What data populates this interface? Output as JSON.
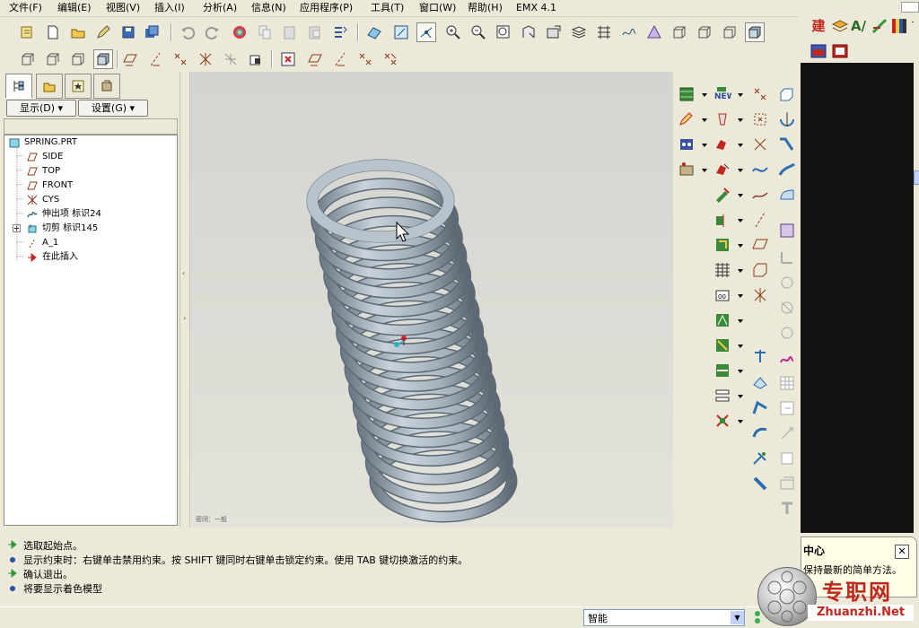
{
  "menu": [
    "文件(F)",
    "编辑(E)",
    "视图(V)",
    "插入(I)",
    "分析(A)",
    "信息(N)",
    "应用程序(P)",
    "工具(T)",
    "窗口(W)",
    "帮助(H)",
    "EMX 4.1"
  ],
  "panel": {
    "show_label": "显示(D)",
    "settings_label": "设置(G)"
  },
  "tree": [
    {
      "label": "SPRING.PRT",
      "icon": "part-icon"
    },
    {
      "label": "SIDE",
      "icon": "datum-plane-icon"
    },
    {
      "label": "TOP",
      "icon": "datum-plane-icon"
    },
    {
      "label": "FRONT",
      "icon": "datum-plane-icon"
    },
    {
      "label": "CYS",
      "icon": "coordinate-system-icon"
    },
    {
      "label": "伸出项 标识24",
      "icon": "sweep-icon"
    },
    {
      "label": "切剪 标识145",
      "icon": "cut-icon"
    },
    {
      "label": "A_1",
      "icon": "axis-icon"
    },
    {
      "label": "在此插入",
      "icon": "insert-here-arrow-icon"
    }
  ],
  "viewport": {
    "note": "密闭：一般"
  },
  "messages": [
    {
      "text": "选取起始点。",
      "icon": "prompt-arrow-icon"
    },
    {
      "text": "显示约束时：右键单击禁用约束。按 SHIFT 键同时右键单击锁定约束。使用 TAB 键切换激活的约束。",
      "icon": "info-dot-icon"
    },
    {
      "text": "确认退出。",
      "icon": "prompt-arrow-icon"
    },
    {
      "text": "将要显示着色模型",
      "icon": "info-dot-icon"
    }
  ],
  "status": {
    "filter": "智能"
  },
  "popup": {
    "title": "中心",
    "body": "保持最新的简单方法。"
  },
  "watermark": {
    "cn": "专职网",
    "en": "Zhuanzhi.Net"
  },
  "colors": {
    "accent": "#2a6fb4",
    "spring": "#a9b4be",
    "datum": "#8b3a1a"
  }
}
